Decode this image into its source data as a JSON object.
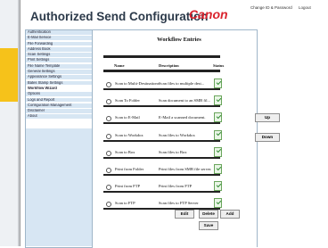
{
  "header": {
    "title": "Authorized Send Configuration",
    "brand": "Canon",
    "links": [
      "Change ID & Password",
      "Logout"
    ]
  },
  "sidebar": {
    "items": [
      {
        "label": "Authentication"
      },
      {
        "label": "E-Mail Service"
      },
      {
        "label": "File Forwarding"
      },
      {
        "label": "Address Book"
      },
      {
        "label": "Scan Settings"
      },
      {
        "label": "Print Settings"
      },
      {
        "label": "File Name Template"
      },
      {
        "label": "General Settings"
      },
      {
        "label": "Appearance Settings"
      },
      {
        "label": "Bates Stamp Settings"
      },
      {
        "label": "Workflow Wizard"
      },
      {
        "label": "Options"
      },
      {
        "label": "Logs and Report"
      },
      {
        "label": "Configuration Management"
      },
      {
        "label": "Disclaimer"
      },
      {
        "label": "About"
      }
    ],
    "active_index": 10
  },
  "workflow": {
    "title": "Workflow Entries",
    "columns": {
      "name": "Name",
      "description": "Description",
      "status": "Status"
    },
    "rows": [
      {
        "name": "Scan to Multi-Destinations",
        "description": "Scan files to multiple dest..."
      },
      {
        "name": "Scan To Folder",
        "description": "Scan document to an SMB fil..."
      },
      {
        "name": "Scan to E-Mail",
        "description": "E-Mail a scanned document."
      },
      {
        "name": "Scan to Workdox",
        "description": "Scan files to Workdox"
      },
      {
        "name": "Scan to Box",
        "description": "Scan files to Box"
      },
      {
        "name": "Print from Folder",
        "description": "Print files from SMB file server."
      },
      {
        "name": "Print from FTP",
        "description": "Print files from FTP"
      },
      {
        "name": "Scan to FTP",
        "description": "Scan files to FTP Server"
      }
    ],
    "buttons": {
      "edit": "Edit",
      "delete": "Delete",
      "add": "Add",
      "save": "Save",
      "up": "Up",
      "down": "Down"
    }
  },
  "colors": {
    "brand": "#d9232d",
    "sidebar_bg": "#d7e6f3",
    "accent_bar": "#f6c21a"
  }
}
